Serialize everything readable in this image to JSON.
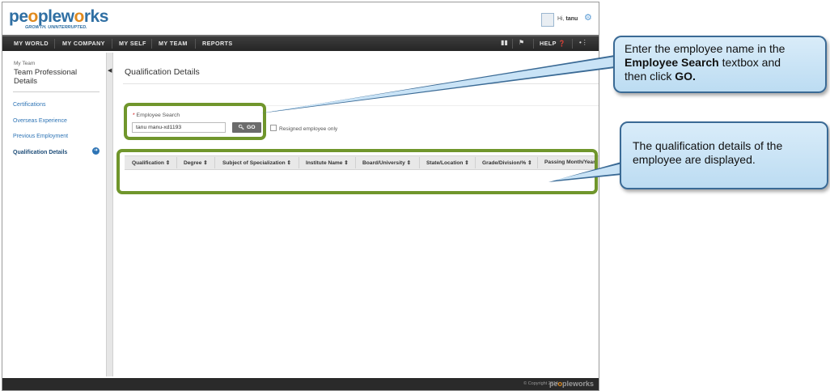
{
  "header": {
    "logo_main_1": "pe",
    "logo_main_o1": "o",
    "logo_main_2": "plew",
    "logo_main_o2": "o",
    "logo_main_3": "rks",
    "tagline": "GROWTH. UNINTERRUPTED.",
    "greeting_prefix": "Hi,",
    "user_name": "tanu",
    "settings_icon": "gear-icon",
    "avatar_icon": "avatar-icon"
  },
  "nav": {
    "items": [
      "MY WORLD",
      "MY COMPANY",
      "MY SELF",
      "MY TEAM",
      "REPORTS"
    ],
    "help_label": "HELP",
    "icons": [
      "book-icon",
      "flag-icon",
      "help-icon",
      "sitemap-icon"
    ]
  },
  "sidebar": {
    "subtitle": "My Team",
    "title": "Team Professional Details",
    "items": [
      {
        "label": "Certifications"
      },
      {
        "label": "Overseas Experience"
      },
      {
        "label": "Previous Employment"
      },
      {
        "label": "Qualification Details",
        "active": true
      }
    ],
    "collapse_icon": "collapse-arrow-icon",
    "active_icon": "arrow-right-circle-icon"
  },
  "main": {
    "page_title": "Qualification Details",
    "search": {
      "required_mark": "*",
      "label": "Employee Search",
      "value": "tanu manu-xd1193",
      "go_label": "GO",
      "resigned_label": "Resigned employee only"
    },
    "grid": {
      "columns": [
        "Qualification",
        "Degree",
        "Subject of Specialization",
        "Institute Name",
        "Board/University",
        "State/Location",
        "Grade/Division/%",
        "Passing Month/Year"
      ],
      "sort_icon": "sort-icon",
      "rows": []
    }
  },
  "footer": {
    "copyright": "© Copyright 2014",
    "logo_1": "pe",
    "logo_o": "o",
    "logo_2": "pleworks"
  },
  "callouts": {
    "search_tip": {
      "line1": "Enter the employee name in the",
      "bold1": "Employee Search",
      "line2": " textbox and",
      "line3": "then click ",
      "bold2": "GO."
    },
    "details_tip": {
      "text": "The qualification details of the employee are displayed."
    }
  },
  "colors": {
    "highlight_border": "#70962c",
    "callout_fill": "#c9e3f6",
    "callout_border": "#3a6a95",
    "nav_bg": "#2f2f2f",
    "link": "#2e74b5"
  }
}
